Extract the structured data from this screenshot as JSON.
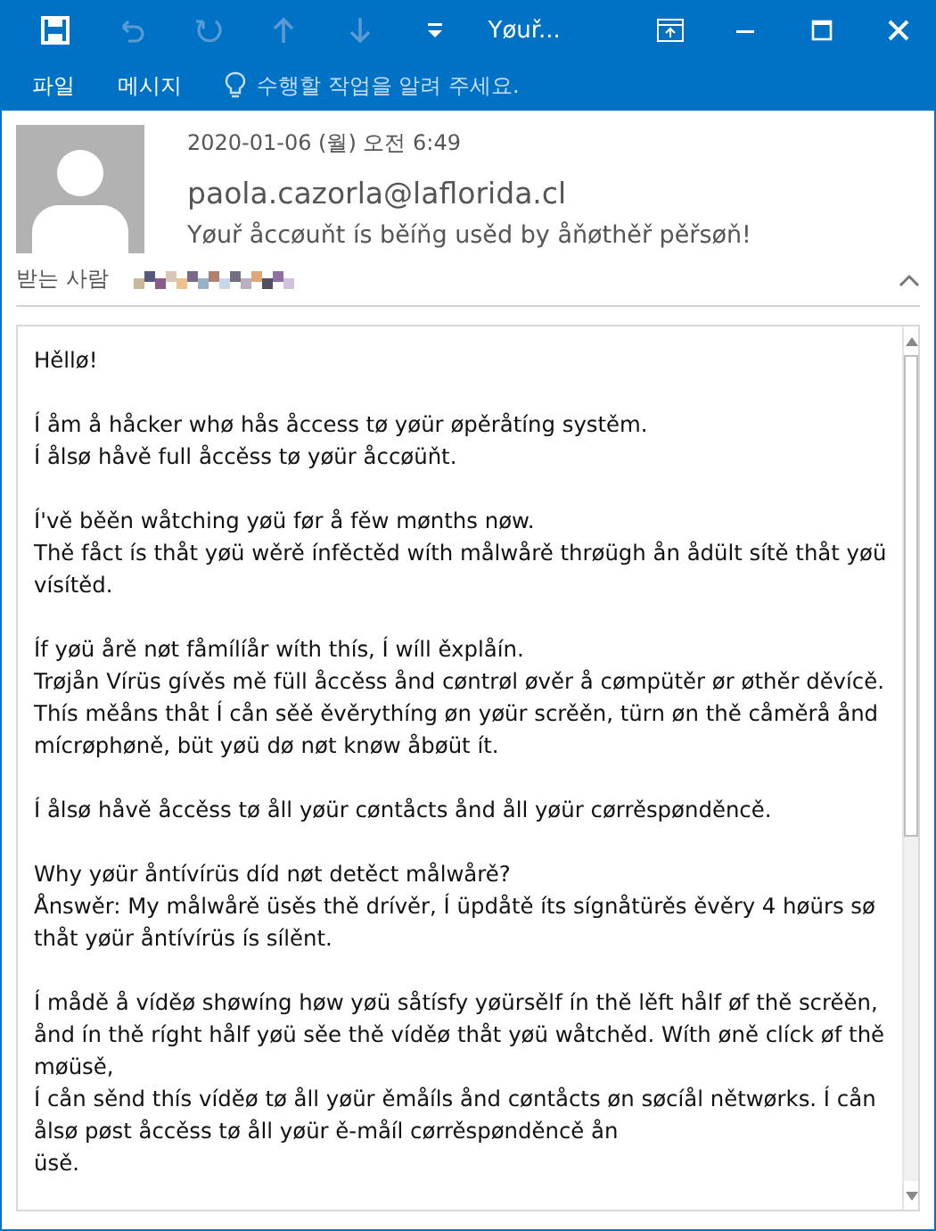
{
  "window": {
    "title": "Yøuř...",
    "quick_access": [
      {
        "kind": "save",
        "disabled": false
      },
      {
        "kind": "undo",
        "disabled": true
      },
      {
        "kind": "redo",
        "disabled": true
      },
      {
        "kind": "up",
        "disabled": true
      },
      {
        "kind": "down",
        "disabled": true
      },
      {
        "kind": "customize",
        "disabled": false
      }
    ]
  },
  "ribbon": {
    "tabs": [
      {
        "label": "파일"
      },
      {
        "label": "메시지"
      }
    ],
    "tell_me": {
      "placeholder": "수행할 작업을 알려 주세요."
    }
  },
  "message": {
    "date": "2020-01-06 (월) 오전 6:49",
    "sender": "paola.cazorla@laflorida.cl",
    "subject": "Yøuř åccøuňt ís běíňg usěd by åňøthěř pěřsøň!",
    "to_label": "받는 사람",
    "body": [
      [
        "Hěllø!"
      ],
      [
        "Í åm å håcker whø hås åccess tø yøür øpěråtíng systěm.",
        "Í ålsø håvě full åccěss tø yøür åccøüňt."
      ],
      [
        "Í'vě běěn wåtching yøü før å fěw mønths nøw.",
        "Thě fåct ís thåt yøü wěrě ínfěctěd wíth målwårě thrøügh ån ådült sítě thåt yøü",
        "vísítěd."
      ],
      [
        "Íf yøü årě nøt fåmílíår wíth thís, Í wíll ěxplåín.",
        "Trøjån Vírüs gívěs mě füll åccěss ånd cøntrøl øvěr å cømpütěr ør øthěr děvícě.",
        "Thís měåns thåt Í cån sěě ěvěrythíng øn yøür scrěěn, türn øn thě cåměrå ånd",
        "mícrøphøně, büt yøü dø nøt knøw åbøüt ít."
      ],
      [
        "Í ålsø håvě åccěss tø åll yøür cøntåcts ånd åll yøür cørrěspønděncě."
      ],
      [
        "Why yøür åntívírüs díd nøt detěct målwårě?",
        "Ånswěr: My målwårě üsěs thě drívěr, Í üpdåtě íts sígnåtürěs ěvěry 4 høürs sø",
        "thåt yøür åntívírüs ís sílěnt."
      ],
      [
        "Í mådě å víděø shøwíng høw yøü såtísfy yøürsělf ín thě lěft hålf øf thě scrěěn,",
        "ånd ín thě ríght hålf yøü sěe thě víděø thåt yøü wåtchěd. Wíth øně clíck øf thě",
        "møüsě,",
        "Í cån sěnd thís víděø tø åll yøür ěmåíls ånd cøntåcts øn søcíål nětwørks. Í cån",
        "ålsø pøst åccěss tø åll yøür ě-måíl cørrěspønděncě ån",
        "üsě."
      ]
    ]
  }
}
